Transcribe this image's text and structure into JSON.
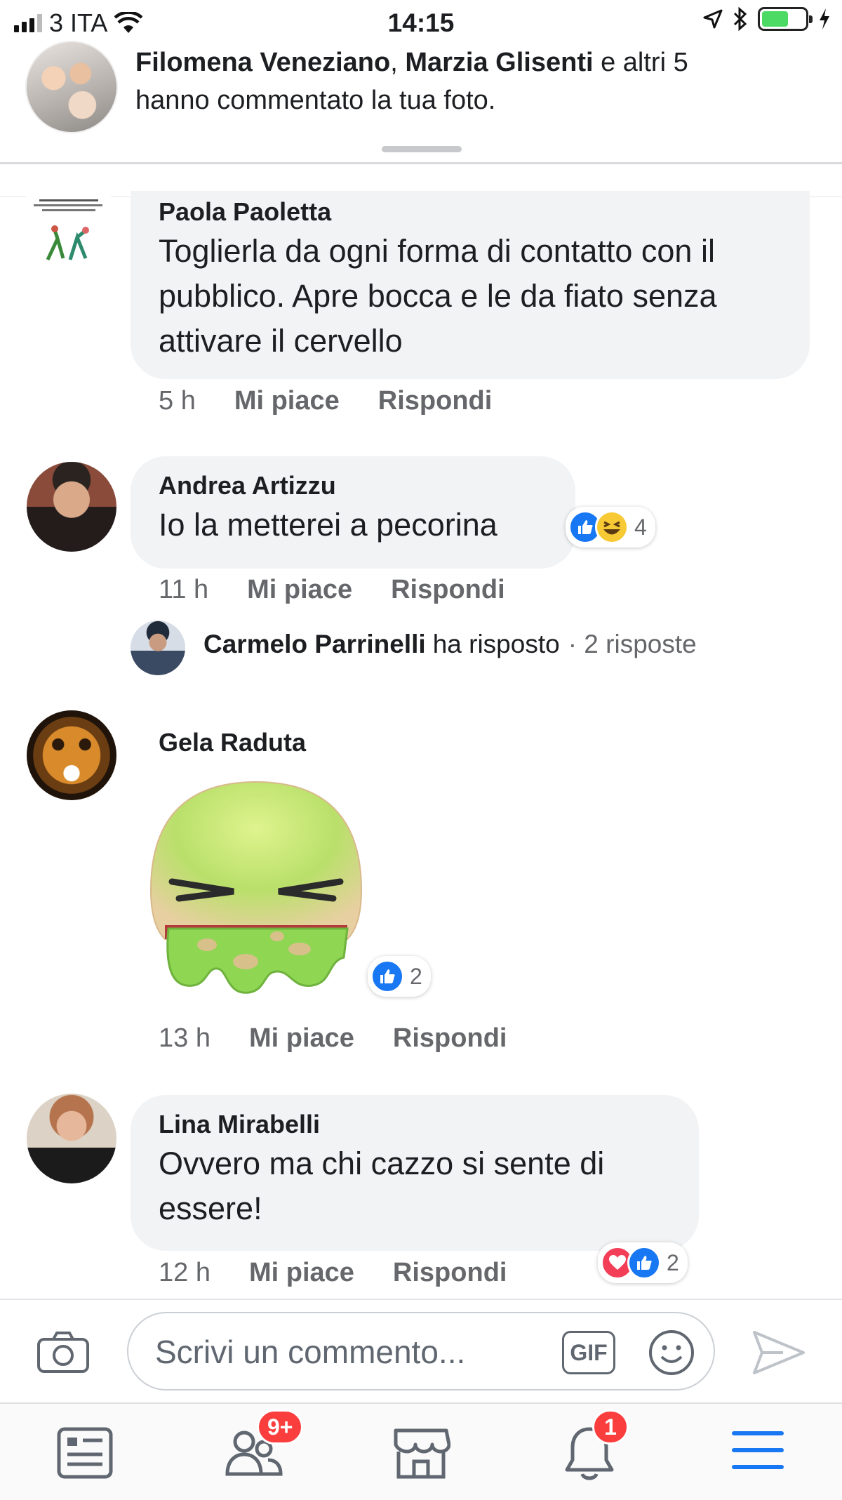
{
  "status_bar": {
    "carrier": "3 ITA",
    "time": "14:15"
  },
  "notification": {
    "name1": "Filomena Veneziano",
    "separator": ", ",
    "name2": "Marzia Glisenti",
    "suffix": " e altri 5",
    "line2": "hanno commentato la tua foto."
  },
  "comments": [
    {
      "author": "Paola Paoletta",
      "text": "Toglierla da ogni forma di contatto con il pubblico.  Apre bocca e le da fiato senza attivare il cervello",
      "time": "5 h",
      "like_label": "Mi piace",
      "reply_label": "Rispondi"
    },
    {
      "author": "Andrea Artizzu",
      "text": "Io la metterei a pecorina",
      "time": "11 h",
      "like_label": "Mi piace",
      "reply_label": "Rispondi",
      "reactions": [
        "like",
        "haha"
      ],
      "reaction_count": "4",
      "reply_summary": {
        "author": "Carmelo Parrinelli",
        "verb": " ha risposto",
        "count": " · 2 risposte"
      }
    },
    {
      "author": "Gela Raduta",
      "sticker": "vomiting-face-sticker",
      "time": "13 h",
      "like_label": "Mi piace",
      "reply_label": "Rispondi",
      "reactions": [
        "like"
      ],
      "reaction_count": "2"
    },
    {
      "author": "Lina Mirabelli",
      "text": "Ovvero ma chi cazzo si sente di essere!",
      "time": "12 h",
      "like_label": "Mi piace",
      "reply_label": "Rispondi",
      "reactions": [
        "love",
        "like"
      ],
      "reaction_count": "2"
    }
  ],
  "composer": {
    "placeholder": "Scrivi un commento...",
    "gif_label": "GIF"
  },
  "tab_bar": {
    "friends_badge": "9+",
    "notifications_badge": "1"
  },
  "colors": {
    "facebook_blue": "#1877f2",
    "badge_red": "#fa3e3e",
    "bubble_gray": "#f2f3f5",
    "muted_text": "#65676b"
  }
}
